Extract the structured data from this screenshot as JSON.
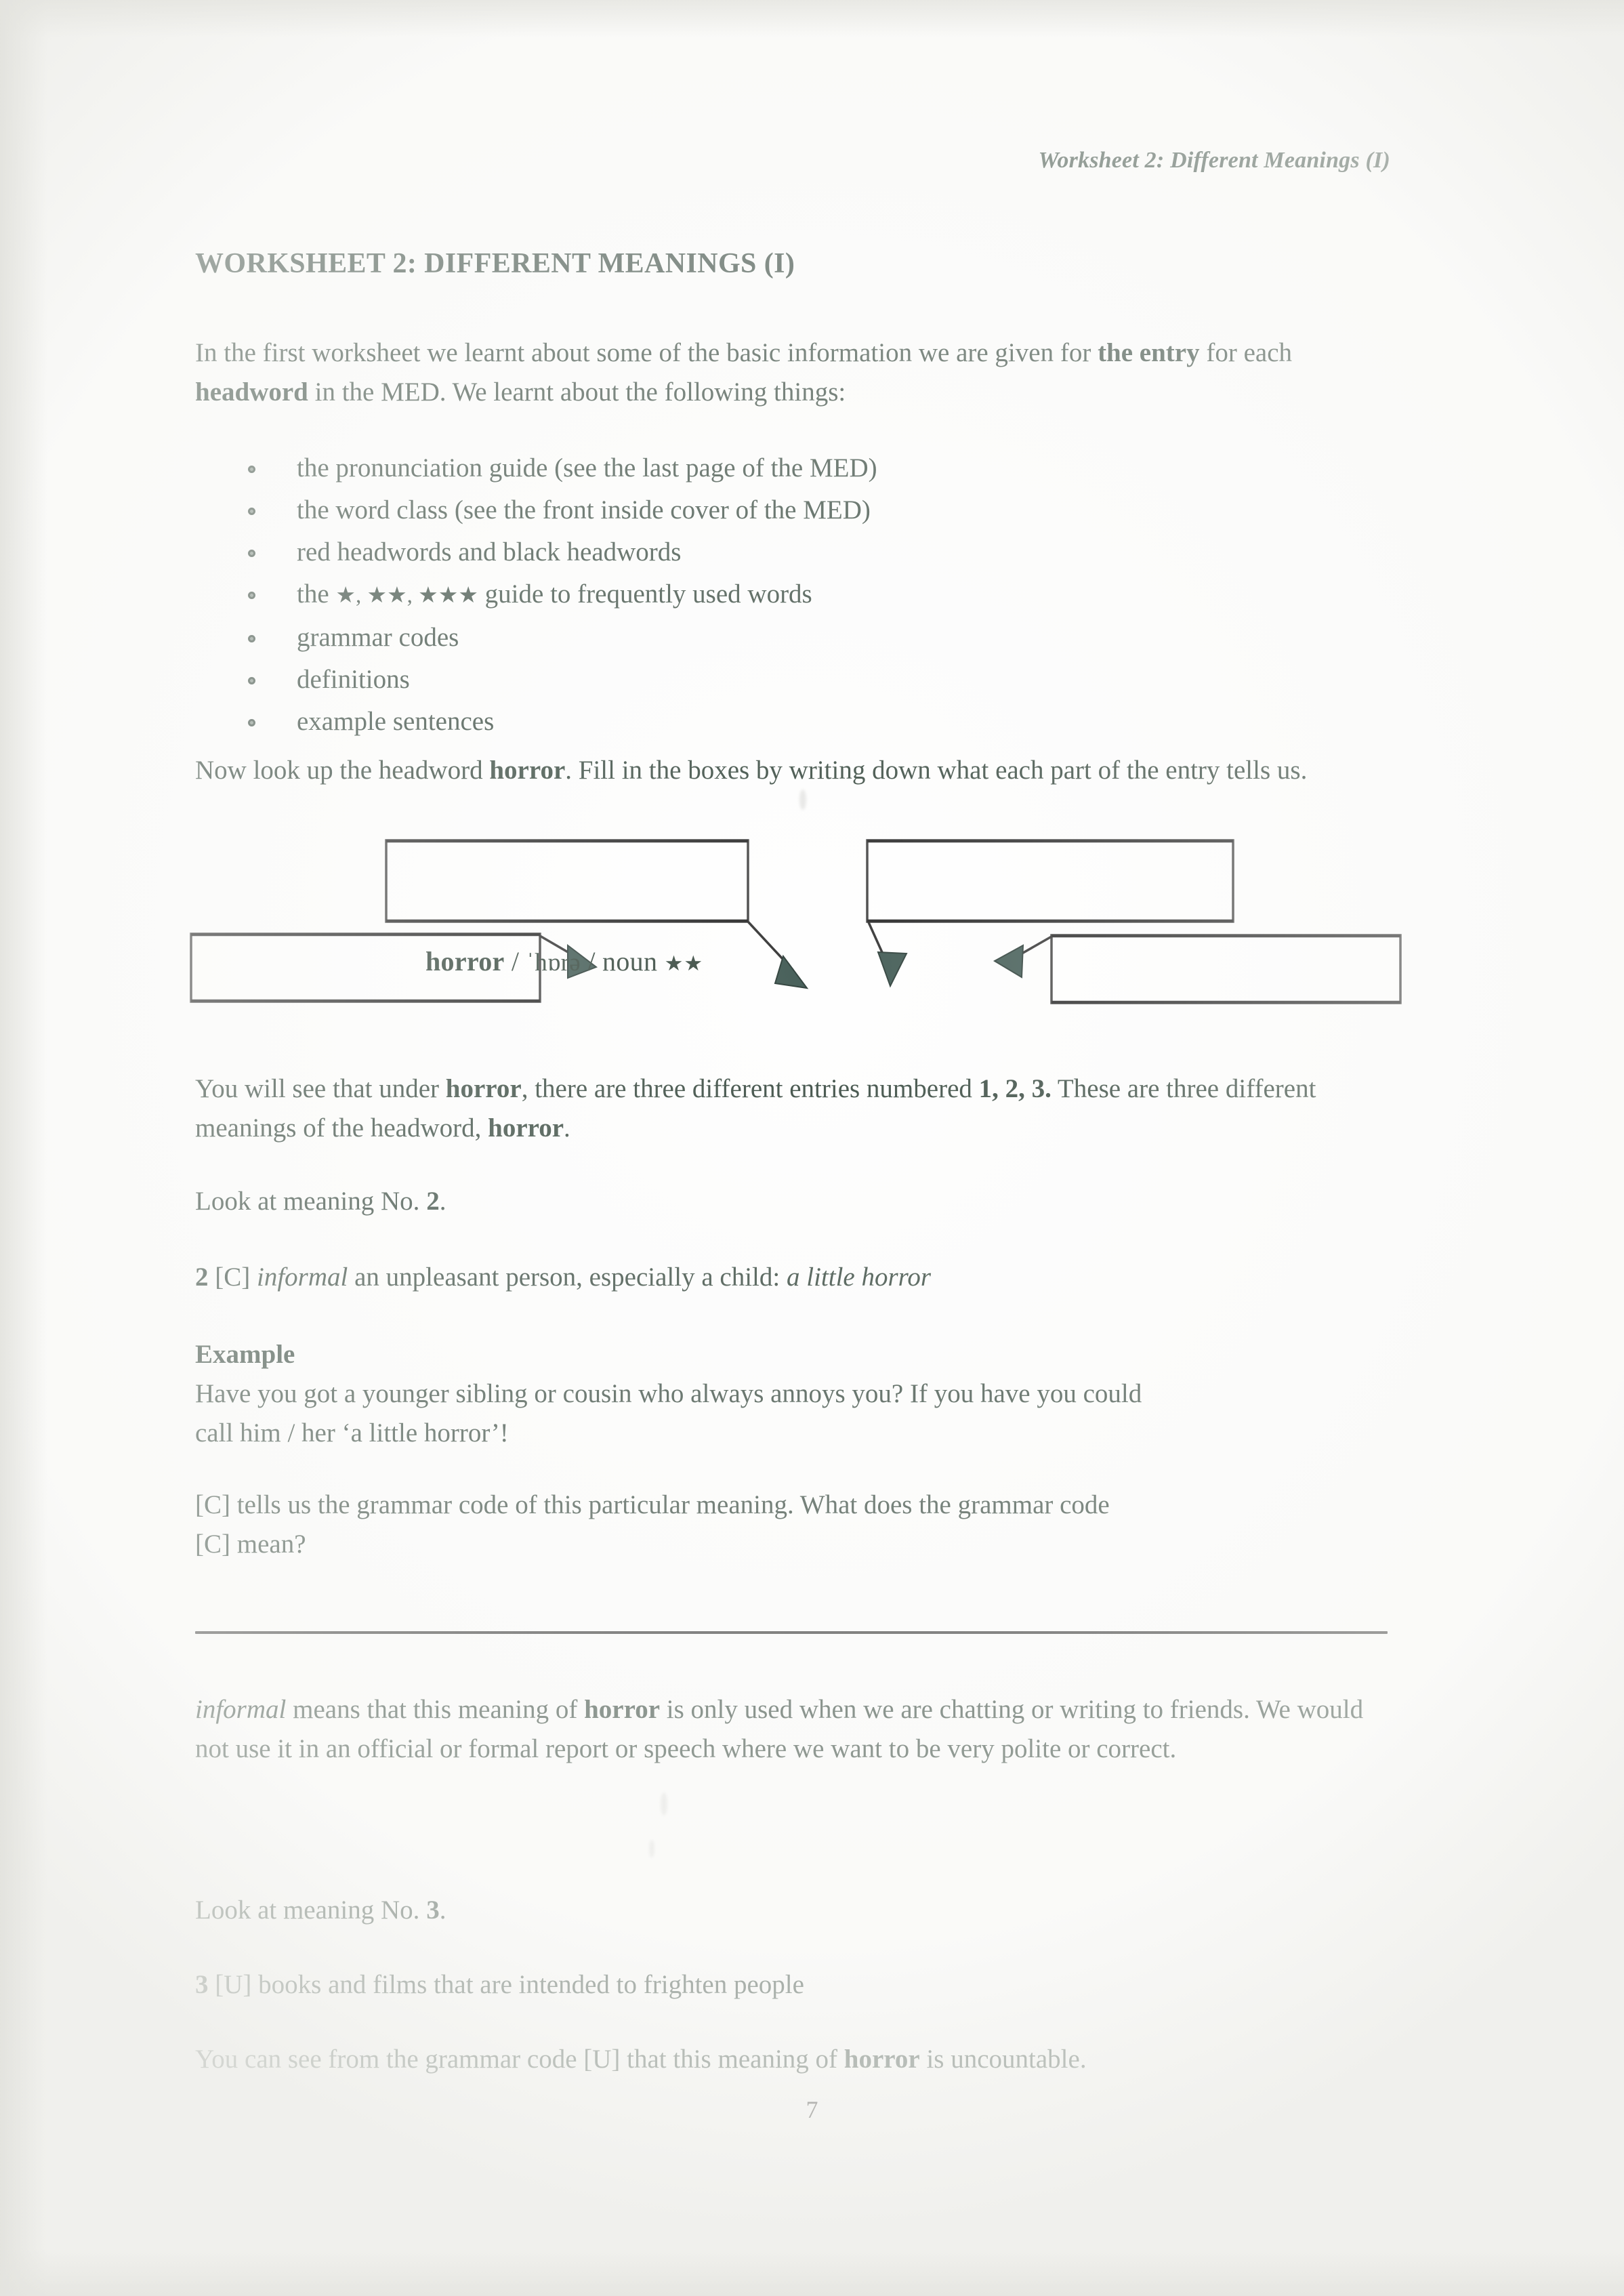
{
  "page": {
    "running_head": "Worksheet 2: Different Meanings (I)",
    "title": "WORKSHEET 2: DIFFERENT MEANINGS (I)",
    "page_number": "7",
    "text_color": "#3e4f46",
    "arrow_color": "#48605a",
    "box_border_color": "#4a4a4a"
  },
  "intro": {
    "line1_a": "In the first worksheet we learnt about some of the basic information we are given for ",
    "line1_b": "the entry",
    "line1_c": " for each ",
    "line1_d": "headword",
    "line1_e": " in the MED. We learnt about the following things:"
  },
  "bullets": [
    {
      "id": "pronunciation-guide",
      "text": "the pronunciation guide (see the last page of the MED)"
    },
    {
      "id": "word-class",
      "text": "the word class (see the front inside cover of the MED)"
    },
    {
      "id": "red-black-headwords",
      "text": "red headwords and black headwords"
    },
    {
      "id": "star-guide",
      "prefix": "the ",
      "stars": "★, ★★, ★★★",
      "suffix": " guide to frequently used words"
    },
    {
      "id": "grammar-codes",
      "text": "grammar codes"
    },
    {
      "id": "definitions",
      "text": "definitions"
    },
    {
      "id": "example-sentences",
      "text": "example sentences"
    }
  ],
  "instruction": {
    "a": "Now look up the headword ",
    "b": "horror",
    "c": ". Fill in the boxes by writing down what each part of the entry tells us."
  },
  "diagram": {
    "entry": {
      "headword": "horror",
      "sep1": " / ",
      "pronunciation": "ˈhɒrə",
      "sep2": " / ",
      "word_class": "noun",
      "frequency_stars": "★★"
    },
    "boxes": [
      {
        "id": "answer-box-top-left",
        "label": "",
        "points_to": "pronunciation"
      },
      {
        "id": "answer-box-top-right",
        "label": "",
        "points_to": "word-class"
      },
      {
        "id": "answer-box-bottom-left",
        "label": "",
        "points_to": "headword"
      },
      {
        "id": "answer-box-bottom-right",
        "label": "",
        "points_to": "frequency-stars"
      }
    ]
  },
  "after_diagram": {
    "a": "You will see that under ",
    "b": "horror",
    "c": ", there are three different entries numbered ",
    "d": "1, 2, 3.",
    "e": " These are three different meanings of the headword, ",
    "f": "horror",
    "g": "."
  },
  "look_meaning_2": {
    "a": "Look at meaning No. ",
    "b": "2",
    "c": "."
  },
  "definition_2": {
    "number": "2",
    "code": " [C] ",
    "register": "informal",
    "gloss": " an unpleasant person, especially a child: ",
    "example": "a little horror"
  },
  "example_block": {
    "heading": "Example",
    "line1": "Have you got a younger sibling or cousin who always annoys you? If you have you could",
    "line2": "call him / her ‘a little horror’!"
  },
  "grammar_question": {
    "line1": "[C] tells us the grammar code of this particular meaning. What does the grammar code",
    "line2": "[C] mean?"
  },
  "informal_note": {
    "a": "informal",
    "b": "  means that this meaning of ",
    "c": "horror",
    "d": " is only used when we are chatting or writing to friends. We would not use it in an official or formal report or speech where we want to be very polite or correct."
  },
  "look_meaning_3": {
    "a": "Look at meaning No. ",
    "b": "3",
    "c": "."
  },
  "definition_3": {
    "number": "3",
    "rest": " [U] books and films that are intended to frighten people"
  },
  "uncountable_note": {
    "a": "You can see from the grammar code [U] that this meaning of ",
    "b": "horror",
    "c": " is uncountable."
  }
}
